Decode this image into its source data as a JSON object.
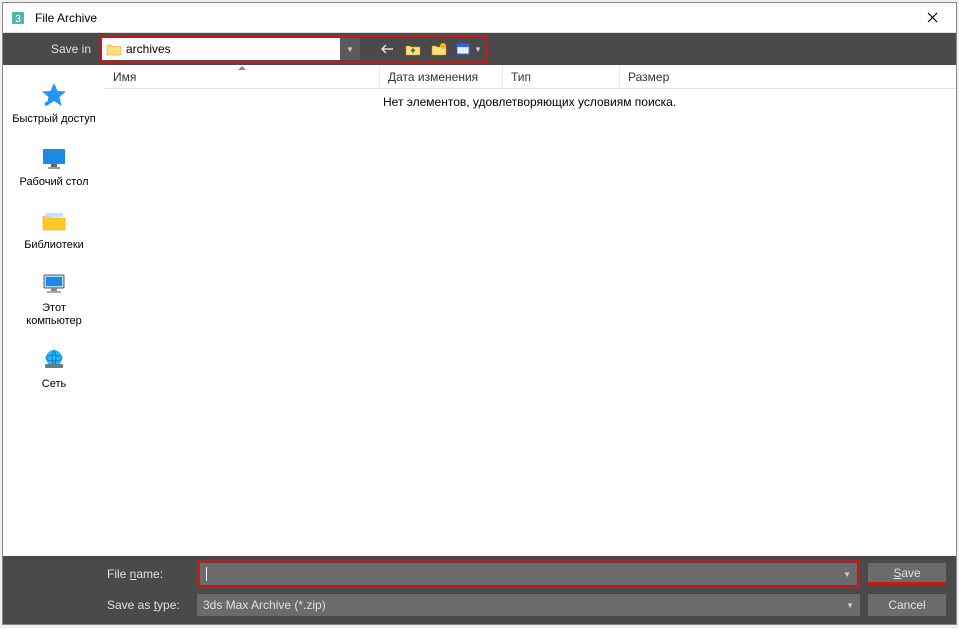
{
  "window": {
    "title": "File Archive"
  },
  "toolbar": {
    "save_in_label": "Save in",
    "location": "archives"
  },
  "columns": {
    "name": "Имя",
    "date": "Дата изменения",
    "type": "Тип",
    "size": "Размер"
  },
  "empty_message": "Нет элементов, удовлетворяющих условиям поиска.",
  "sidebar": {
    "quick_access": "Быстрый доступ",
    "desktop": "Рабочий стол",
    "libraries": "Библиотеки",
    "this_pc_line1": "Этот",
    "this_pc_line2": "компьютер",
    "network": "Сеть"
  },
  "bottom": {
    "file_name_label_prefix": "File ",
    "file_name_label_key": "n",
    "file_name_label_suffix": "ame:",
    "file_name_value": "",
    "save_as_type_label": "Save as ",
    "save_as_type_key": "t",
    "save_as_type_suffix": "ype:",
    "save_as_type_value": "3ds Max Archive (*.zip)",
    "save_prefix": "",
    "save_key": "S",
    "save_suffix": "ave",
    "cancel": "Cancel"
  }
}
